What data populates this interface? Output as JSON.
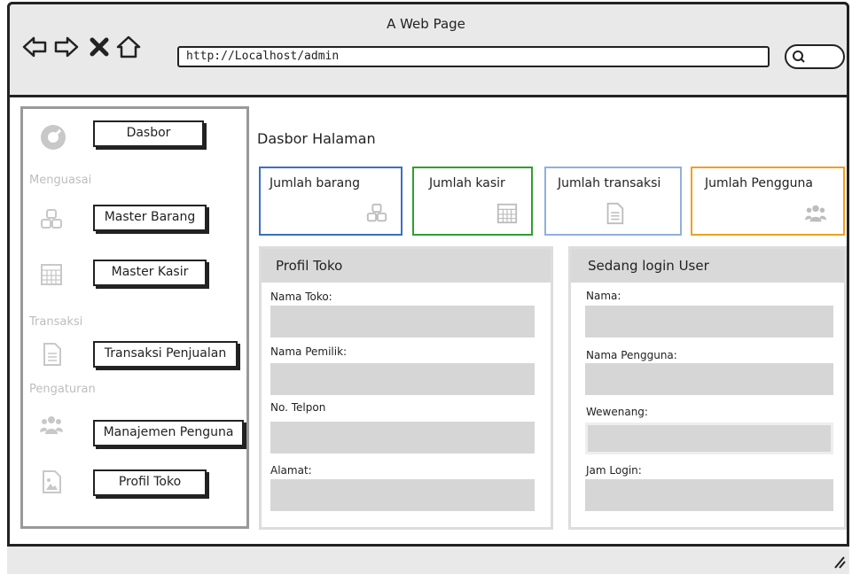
{
  "browser": {
    "title": "A Web Page",
    "url": "http://Localhost/admin"
  },
  "sidebar": {
    "dashboard_label": "Dasbor",
    "section_master": "Menguasai",
    "master_barang_label": "Master Barang",
    "master_kasir_label": "Master Kasir",
    "section_transaksi": "Transaksi",
    "transaksi_label": "Transaksi Penjualan",
    "section_pengaturan": "Pengaturan",
    "manajemen_label": "Manajemen Penguna",
    "profil_label": "Profil Toko"
  },
  "main": {
    "title": "Dasbor Halaman",
    "cards": [
      {
        "label": "Jumlah barang",
        "color": "#3b6fc4",
        "icon": "boxes-icon"
      },
      {
        "label": "Jumlah kasir",
        "color": "#2ea02e",
        "icon": "calculator-icon"
      },
      {
        "label": "Jumlah transaksi",
        "color": "#8fb0dc",
        "icon": "document-icon"
      },
      {
        "label": "Jumlah Pengguna",
        "color": "#f0a020",
        "icon": "users-icon"
      }
    ],
    "profile_panel": {
      "title": "Profil Toko",
      "fields": [
        "Nama Toko:",
        "Nama Pemilik:",
        "No. Telpon",
        "Alamat:"
      ]
    },
    "user_panel": {
      "title": "Sedang login User",
      "fields": [
        "Nama:",
        "Nama Pengguna:",
        "Wewenang:",
        "Jam Login:"
      ]
    }
  }
}
